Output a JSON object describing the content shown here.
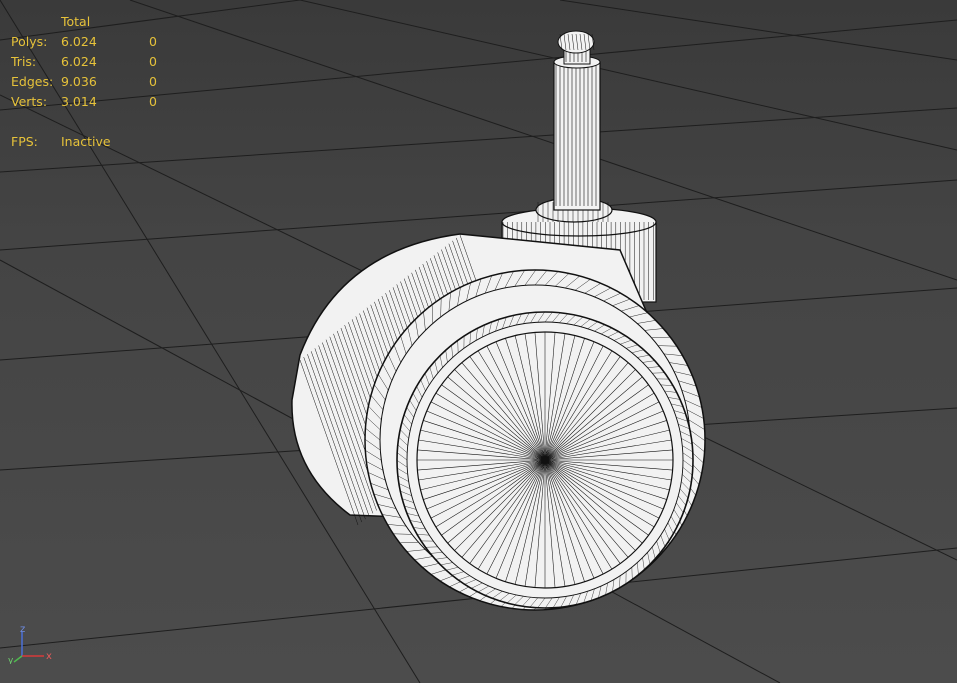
{
  "stats": {
    "total_label": "Total",
    "rows": [
      {
        "label": "Polys:",
        "total": "6.024",
        "selected": "0"
      },
      {
        "label": "Tris:",
        "total": "6.024",
        "selected": "0"
      },
      {
        "label": "Edges:",
        "total": "9.036",
        "selected": "0"
      },
      {
        "label": "Verts:",
        "total": "3.014",
        "selected": "0"
      }
    ],
    "fps_label": "FPS:",
    "fps_value": "Inactive",
    "color": "#e6c23a"
  },
  "axis_tripod": {
    "x": "x",
    "y": "y",
    "z": "z"
  },
  "scene": {
    "object": "caster wheel wireframe mesh",
    "background_color": "#4a4a4a",
    "grid_color": "#1e1e1e",
    "mesh_fill": "#f2f2f2",
    "wire_color": "#111111"
  }
}
